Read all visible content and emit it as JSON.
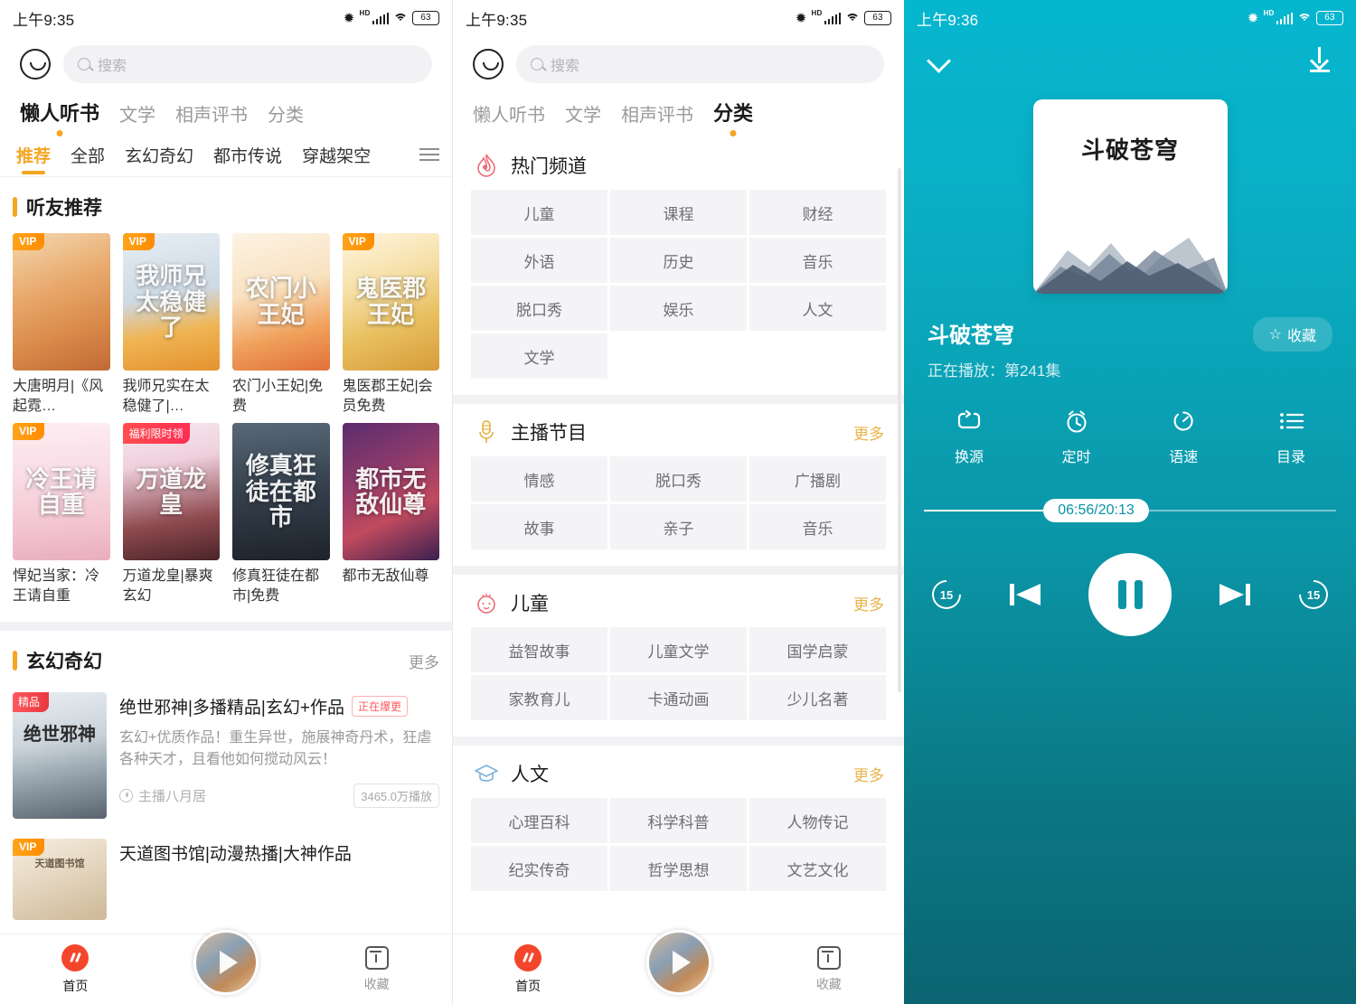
{
  "status_bar": {
    "time_left": "上午9:35",
    "time_right": "上午9:36",
    "battery": "63",
    "hd": "HD"
  },
  "search": {
    "placeholder": "搜索"
  },
  "panel1": {
    "main_tabs": [
      {
        "label": "懒人听书",
        "active": true
      },
      {
        "label": "文学",
        "active": false
      },
      {
        "label": "相声评书",
        "active": false
      },
      {
        "label": "分类",
        "active": false
      }
    ],
    "sub_tabs": [
      {
        "label": "推荐",
        "active": true
      },
      {
        "label": "全部",
        "active": false
      },
      {
        "label": "玄幻奇幻",
        "active": false
      },
      {
        "label": "都市传说",
        "active": false
      },
      {
        "label": "穿越架空",
        "active": false
      }
    ],
    "section1": {
      "title": "听友推荐"
    },
    "books": [
      {
        "title": "大唐明月|《风起霓…",
        "badge": "VIP",
        "badge_type": "vip",
        "cover_text": ""
      },
      {
        "title": "我师兄实在太稳健了|…",
        "badge": "VIP",
        "badge_type": "vip",
        "cover_text": "我师兄太稳健了"
      },
      {
        "title": "农门小王妃|免费",
        "badge": "",
        "badge_type": "",
        "cover_text": "农门小王妃"
      },
      {
        "title": "鬼医郡王妃|会员免费",
        "badge": "VIP",
        "badge_type": "vip",
        "cover_text": "鬼医郡王妃"
      },
      {
        "title": "悍妃当家：冷王请自重",
        "badge": "VIP",
        "badge_type": "vip",
        "cover_text": "冷王请自重"
      },
      {
        "title": "万道龙皇|暴爽玄幻",
        "badge": "福利限时领",
        "badge_type": "fuli",
        "cover_text": "万道龙皇"
      },
      {
        "title": "修真狂徒在都市|免费",
        "badge": "",
        "badge_type": "",
        "cover_text": "修真狂徒在都市"
      },
      {
        "title": "都市无敌仙尊",
        "badge": "",
        "badge_type": "",
        "cover_text": "都市无敌仙尊"
      }
    ],
    "section2": {
      "title": "玄幻奇幻",
      "more": "更多"
    },
    "list_items": [
      {
        "title": "绝世邪神|多播精品|玄幻+作品",
        "tag": "正在爆更",
        "badge": "精品",
        "cover_text": "绝世邪神",
        "desc": "玄幻+优质作品！重生异世，施展神奇丹术，狂虐各种天才，且看他如何搅动风云！",
        "anchor": "主播八月居",
        "plays": "3465.0万播放"
      },
      {
        "title": "天道图书馆|动漫热播|大神作品",
        "tag": "",
        "badge": "VIP",
        "cover_text": "天道图书馆",
        "desc": "",
        "anchor": "",
        "plays": ""
      }
    ],
    "bottom_nav": [
      {
        "label": "首页",
        "icon": "home-icon",
        "active": true
      },
      {
        "label": "收藏",
        "icon": "favorite-icon",
        "active": false
      }
    ]
  },
  "panel2": {
    "main_tabs": [
      {
        "label": "懒人听书",
        "active": false
      },
      {
        "label": "文学",
        "active": false
      },
      {
        "label": "相声评书",
        "active": false
      },
      {
        "label": "分类",
        "active": true
      }
    ],
    "sections": [
      {
        "title": "热门频道",
        "icon": "flame-icon",
        "more": "",
        "chips": [
          "儿童",
          "课程",
          "财经",
          "外语",
          "历史",
          "音乐",
          "脱口秀",
          "娱乐",
          "人文",
          "文学"
        ]
      },
      {
        "title": "主播节目",
        "icon": "microphone-icon",
        "more": "更多",
        "chips": [
          "情感",
          "脱口秀",
          "广播剧",
          "故事",
          "亲子",
          "音乐"
        ]
      },
      {
        "title": "儿童",
        "icon": "baby-face-icon",
        "more": "更多",
        "chips": [
          "益智故事",
          "儿童文学",
          "国学启蒙",
          "家教育儿",
          "卡通动画",
          "少儿名著"
        ]
      },
      {
        "title": "人文",
        "icon": "graduation-cap-icon",
        "more": "更多",
        "chips": [
          "心理百科",
          "科学科普",
          "人物传记",
          "纪实传奇",
          "哲学思想",
          "文艺文化"
        ]
      }
    ],
    "bottom_nav": [
      {
        "label": "首页",
        "icon": "home-icon",
        "active": true
      },
      {
        "label": "收藏",
        "icon": "favorite-icon",
        "active": false
      }
    ]
  },
  "panel3": {
    "album_title": "斗破苍穹",
    "book_title": "斗破苍穹",
    "now_playing": "正在播放：第241集",
    "favorite_label": "收藏",
    "tools": [
      {
        "label": "换源",
        "icon": "repeat-source-icon"
      },
      {
        "label": "定时",
        "icon": "alarm-clock-icon"
      },
      {
        "label": "语速",
        "icon": "speed-icon"
      },
      {
        "label": "目录",
        "icon": "list-catalog-icon"
      }
    ],
    "progress": {
      "current": "06:56",
      "total": "20:13",
      "display": "06:56/20:13",
      "percent": 34
    },
    "controls": {
      "rewind": "15",
      "forward": "15",
      "prev": "previous-track-icon",
      "next": "next-track-icon",
      "play_state": "pause-icon"
    }
  }
}
